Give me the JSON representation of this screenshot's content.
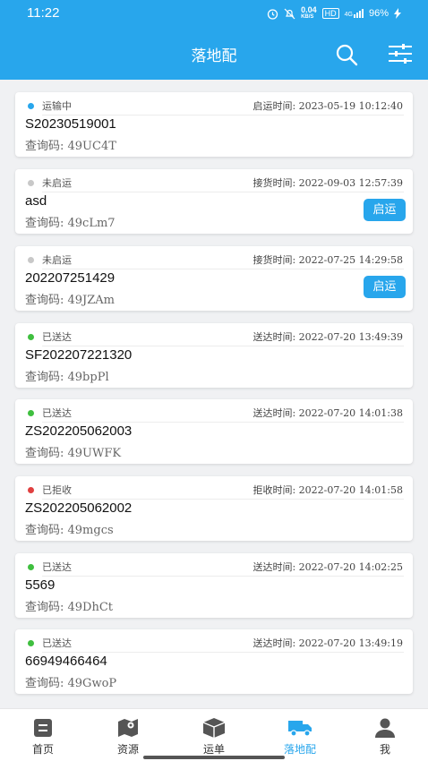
{
  "status_bar": {
    "time": "11:22",
    "net_speed": "0.04",
    "net_unit": "KB/S",
    "hd": "HD",
    "signal": "4G",
    "battery": "96%"
  },
  "appbar": {
    "title": "落地配",
    "search_icon": "search-icon",
    "filter_icon": "filter-icon"
  },
  "colors": {
    "primary": "#28a6ec",
    "in_transit": "#28a6ec",
    "not_started": "#c8c8c8",
    "delivered": "#3fbf3f",
    "rejected": "#e04040"
  },
  "orders": [
    {
      "status": "运输中",
      "time": "启运时间: 2023-05-19 10:12:40",
      "code": "S20230519001",
      "query": "查询码: 49UC4T",
      "dot": "#28a6ec",
      "button": ""
    },
    {
      "status": "未启运",
      "time": "接货时间: 2022-09-03 12:57:39",
      "code": "asd",
      "query": "查询码: 49cLm7",
      "dot": "#c8c8c8",
      "button": "启运"
    },
    {
      "status": "未启运",
      "time": "接货时间: 2022-07-25 14:29:58",
      "code": "202207251429",
      "query": "查询码: 49JZAm",
      "dot": "#c8c8c8",
      "button": "启运"
    },
    {
      "status": "已送达",
      "time": "送达时间: 2022-07-20 13:49:39",
      "code": "SF202207221320",
      "query": "查询码: 49bpPl",
      "dot": "#3fbf3f",
      "button": ""
    },
    {
      "status": "已送达",
      "time": "送达时间: 2022-07-20 14:01:38",
      "code": "ZS202205062003",
      "query": "查询码: 49UWFK",
      "dot": "#3fbf3f",
      "button": ""
    },
    {
      "status": "已拒收",
      "time": "拒收时间: 2022-07-20 14:01:58",
      "code": "ZS202205062002",
      "query": "查询码: 49mgcs",
      "dot": "#e04040",
      "button": ""
    },
    {
      "status": "已送达",
      "time": "送达时间: 2022-07-20 14:02:25",
      "code": "5569",
      "query": "查询码: 49DhCt",
      "dot": "#3fbf3f",
      "button": ""
    },
    {
      "status": "已送达",
      "time": "送达时间: 2022-07-20 13:49:19",
      "code": "66949466464",
      "query": "查询码: 49GwoP",
      "dot": "#3fbf3f",
      "button": ""
    }
  ],
  "tabs": [
    {
      "label": "首页",
      "icon": "home-icon"
    },
    {
      "label": "资源",
      "icon": "map-icon"
    },
    {
      "label": "运单",
      "icon": "box-icon"
    },
    {
      "label": "落地配",
      "icon": "truck-icon",
      "active": true
    },
    {
      "label": "我",
      "icon": "user-icon"
    }
  ]
}
